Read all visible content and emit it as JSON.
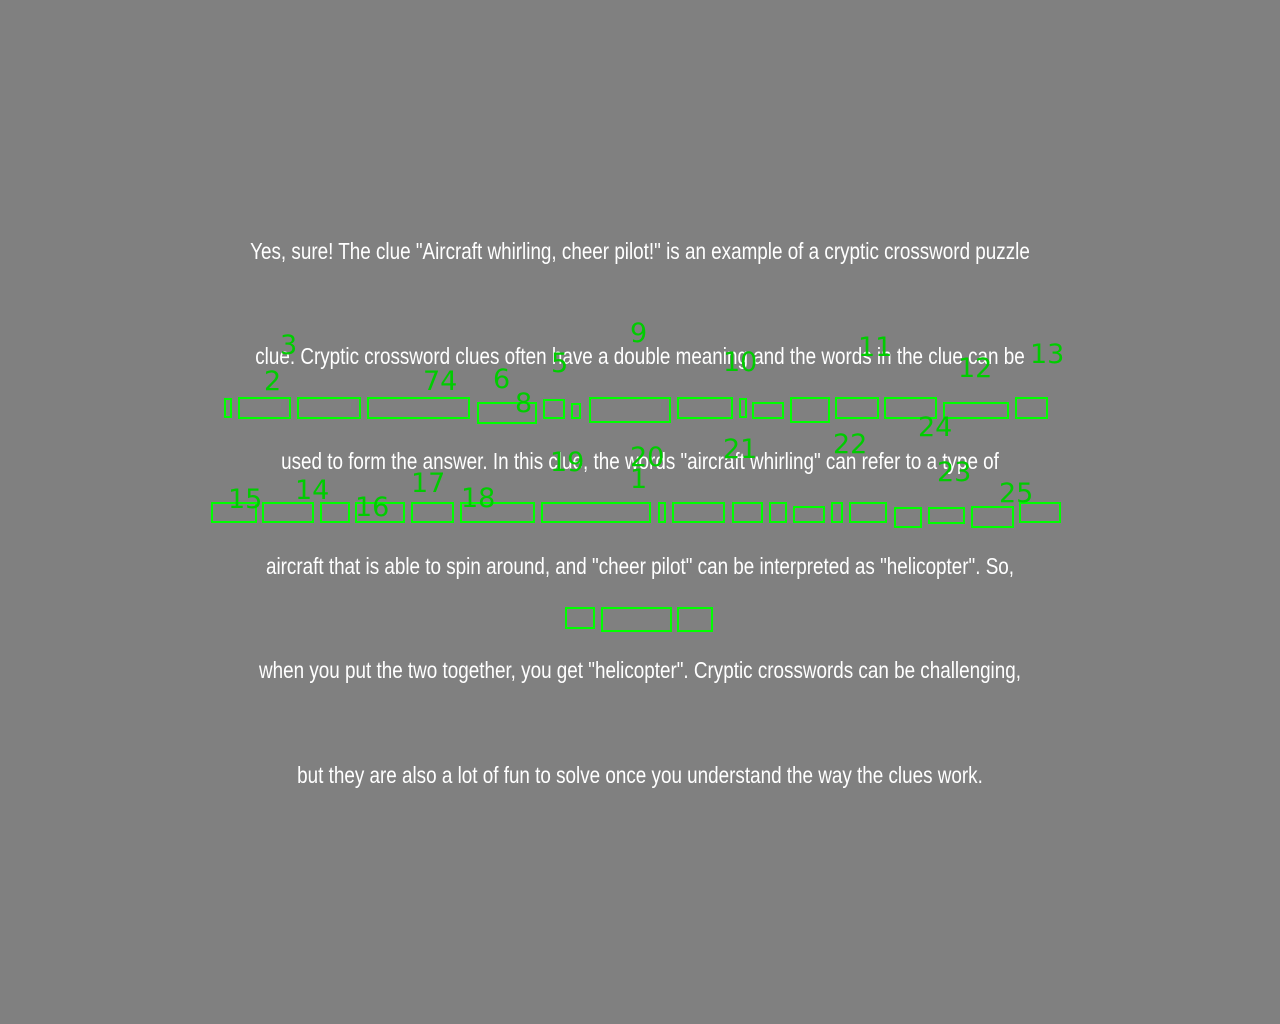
{
  "screen": {
    "background": "#808080",
    "text_color": "#ffffff",
    "highlight_color": "#00ff00",
    "label_color": "#00cc00"
  },
  "text": {
    "lines": [
      "Yes, sure! The clue \"Aircraft whirling, cheer pilot!\" is an example of a cryptic crossword puzzle",
      "clue. Cryptic crossword clues often have a double meaning and the words in the clue can be",
      "used to form the answer. In this clue, the words \"aircraft whirling\" can refer to a type of",
      "aircraft that is able to spin around, and \"cheer pilot\" can be interpreted as \"helicopter\". So,",
      "when you put the two together, you get \"helicopter\". Cryptic crosswords can be challenging,",
      "but they are also a lot of fun to solve once you understand the way the clues work."
    ]
  },
  "overlay_labels": [
    "3",
    "2",
    "74",
    "6",
    "8",
    "5",
    "9",
    "10",
    "11",
    "12",
    "13",
    "24",
    "15",
    "14",
    "16",
    "17",
    "18",
    "19",
    "20",
    "1",
    "21",
    "22",
    "23",
    "25"
  ]
}
